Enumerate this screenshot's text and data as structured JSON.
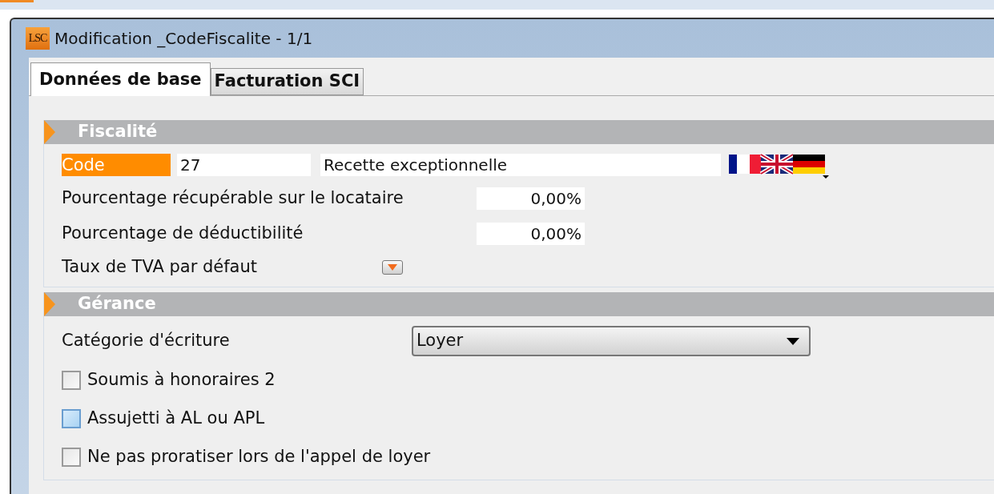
{
  "window": {
    "logo": "LSC",
    "title": "Modification _CodeFiscalite - 1/1"
  },
  "tabs": [
    {
      "label": "Données de base",
      "selected": true
    },
    {
      "label": "Facturation SCI",
      "selected": false
    }
  ],
  "sections": [
    {
      "title": "Fiscalité",
      "rows": [
        {
          "kind": "code",
          "label": "Code",
          "value": "27",
          "description": "Recette exceptionnelle"
        },
        {
          "kind": "percent",
          "label": "Pourcentage récupérable sur le locataire",
          "value": "0,00%"
        },
        {
          "kind": "percent",
          "label": "Pourcentage de déductibilité",
          "value": "0,00%"
        },
        {
          "kind": "picker",
          "label": "Taux de TVA par défaut"
        }
      ]
    },
    {
      "title": "Gérance",
      "rows": [
        {
          "kind": "select",
          "label": "Catégorie d'écriture",
          "value": "Loyer"
        },
        {
          "kind": "checkbox",
          "label": "Soumis à honoraires 2",
          "checked": false,
          "focused": false
        },
        {
          "kind": "checkbox",
          "label": "Assujetti à AL ou APL",
          "checked": false,
          "focused": true
        },
        {
          "kind": "checkbox",
          "label": "Ne pas proratiser lors de l'appel de loyer",
          "checked": false,
          "focused": false
        }
      ]
    }
  ]
}
